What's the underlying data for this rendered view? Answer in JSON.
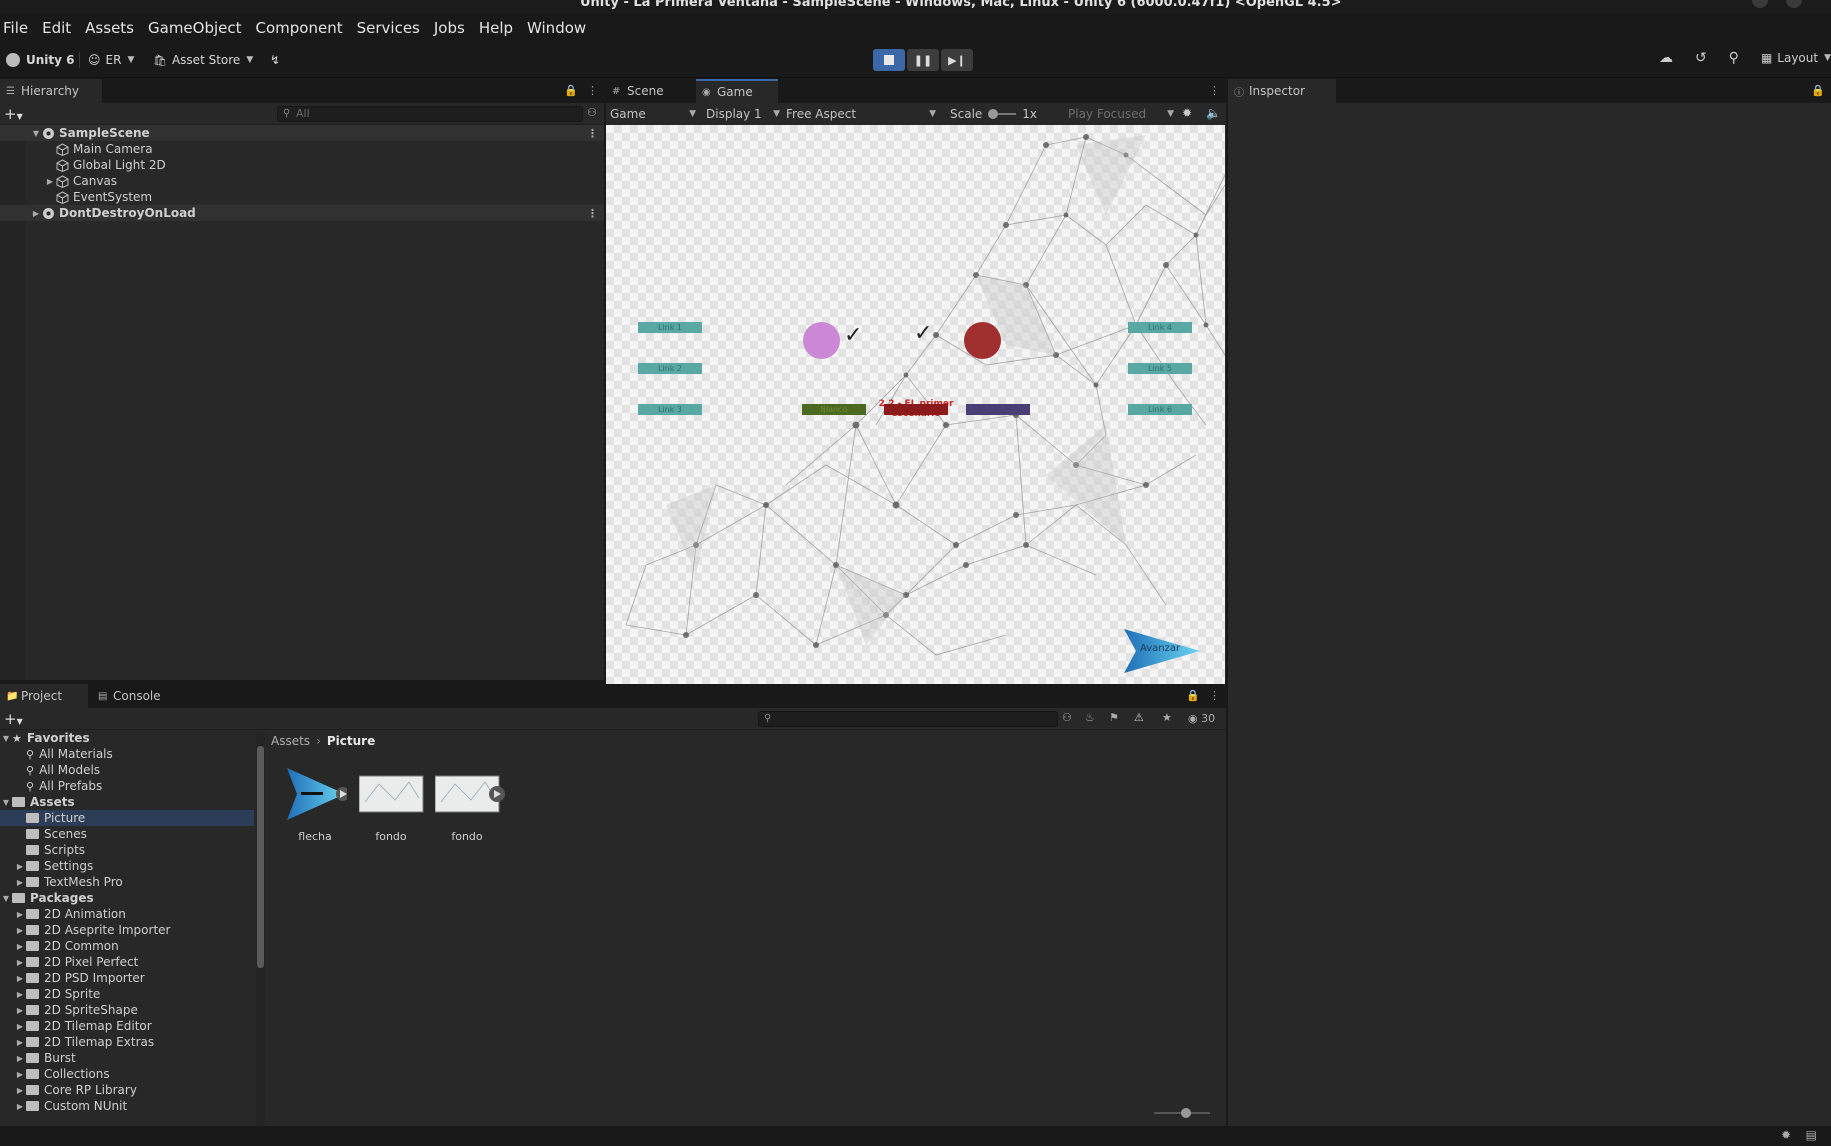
{
  "window": {
    "title": "Unity - La Primera Ventana - SampleScene - Windows, Mac, Linux - Unity 6 (6000.0.47f1) <OpenGL 4.5>"
  },
  "menu": [
    "File",
    "Edit",
    "Assets",
    "GameObject",
    "Component",
    "Services",
    "Jobs",
    "Help",
    "Window"
  ],
  "toolbar": {
    "unity_label": "Unity 6",
    "account": "ER",
    "asset_store": "Asset Store",
    "layout": "Layout",
    "play_active": true
  },
  "hierarchy": {
    "tab": "Hierarchy",
    "search_placeholder": "All",
    "items": [
      {
        "label": "SampleScene",
        "level": 0,
        "type": "scene",
        "expanded": true
      },
      {
        "label": "Main Camera",
        "level": 1,
        "type": "object"
      },
      {
        "label": "Global Light 2D",
        "level": 1,
        "type": "object"
      },
      {
        "label": "Canvas",
        "level": 1,
        "type": "object",
        "collapsed": true
      },
      {
        "label": "EventSystem",
        "level": 1,
        "type": "object"
      },
      {
        "label": "DontDestroyOnLoad",
        "level": 0,
        "type": "scene",
        "collapsed": true
      }
    ]
  },
  "game_view": {
    "tabs": [
      "Scene",
      "Game"
    ],
    "active_tab": "Game",
    "mode": "Game",
    "display": "Display 1",
    "aspect": "Free Aspect",
    "scale_label": "Scale",
    "scale_value": "1x",
    "play_focused": "Play Focused",
    "links_left": [
      "Link 1",
      "Link 2",
      "Link 3"
    ],
    "links_right": [
      "Link 4",
      "Link 5",
      "Link 6"
    ],
    "title_text": "2.2 - EL primer escenario",
    "color_buttons": [
      {
        "label": "Blanco",
        "color": "#4b6a1f"
      },
      {
        "label": "",
        "color": "#8b1a1a"
      },
      {
        "label": "",
        "color": "#4b3e74"
      }
    ],
    "circle_left_color": "#cc88d6",
    "circle_right_color": "#a22f2f",
    "next_button": "Avanzar"
  },
  "inspector": {
    "tab": "Inspector"
  },
  "project": {
    "tabs": [
      "Project",
      "Console"
    ],
    "badge_count": "30",
    "breadcrumb": [
      "Assets",
      "Picture"
    ],
    "tree": [
      {
        "label": "Favorites",
        "level": 0,
        "kind": "header",
        "icon": "star-icon"
      },
      {
        "label": "All Materials",
        "level": 1,
        "kind": "search"
      },
      {
        "label": "All Models",
        "level": 1,
        "kind": "search"
      },
      {
        "label": "All Prefabs",
        "level": 1,
        "kind": "search"
      },
      {
        "label": "Assets",
        "level": 0,
        "kind": "header",
        "icon": "folder-icon"
      },
      {
        "label": "Picture",
        "level": 1,
        "kind": "folder",
        "selected": true
      },
      {
        "label": "Scenes",
        "level": 1,
        "kind": "folder"
      },
      {
        "label": "Scripts",
        "level": 1,
        "kind": "folder"
      },
      {
        "label": "Settings",
        "level": 1,
        "kind": "folder",
        "collapsed": true
      },
      {
        "label": "TextMesh Pro",
        "level": 1,
        "kind": "folder",
        "collapsed": true
      },
      {
        "label": "Packages",
        "level": 0,
        "kind": "header",
        "icon": "folder-icon"
      },
      {
        "label": "2D Animation",
        "level": 1,
        "kind": "folder",
        "collapsed": true
      },
      {
        "label": "2D Aseprite Importer",
        "level": 1,
        "kind": "folder",
        "collapsed": true
      },
      {
        "label": "2D Common",
        "level": 1,
        "kind": "folder",
        "collapsed": true
      },
      {
        "label": "2D Pixel Perfect",
        "level": 1,
        "kind": "folder",
        "collapsed": true
      },
      {
        "label": "2D PSD Importer",
        "level": 1,
        "kind": "folder",
        "collapsed": true
      },
      {
        "label": "2D Sprite",
        "level": 1,
        "kind": "folder",
        "collapsed": true
      },
      {
        "label": "2D SpriteShape",
        "level": 1,
        "kind": "folder",
        "collapsed": true
      },
      {
        "label": "2D Tilemap Editor",
        "level": 1,
        "kind": "folder",
        "collapsed": true
      },
      {
        "label": "2D Tilemap Extras",
        "level": 1,
        "kind": "folder",
        "collapsed": true
      },
      {
        "label": "Burst",
        "level": 1,
        "kind": "folder",
        "collapsed": true
      },
      {
        "label": "Collections",
        "level": 1,
        "kind": "folder",
        "collapsed": true
      },
      {
        "label": "Core RP Library",
        "level": 1,
        "kind": "folder",
        "collapsed": true
      },
      {
        "label": "Custom NUnit",
        "level": 1,
        "kind": "folder",
        "collapsed": true
      }
    ],
    "assets": [
      {
        "label": "flecha",
        "kind": "arrow"
      },
      {
        "label": "fondo",
        "kind": "image"
      },
      {
        "label": "fondo",
        "kind": "image-anim"
      }
    ]
  }
}
